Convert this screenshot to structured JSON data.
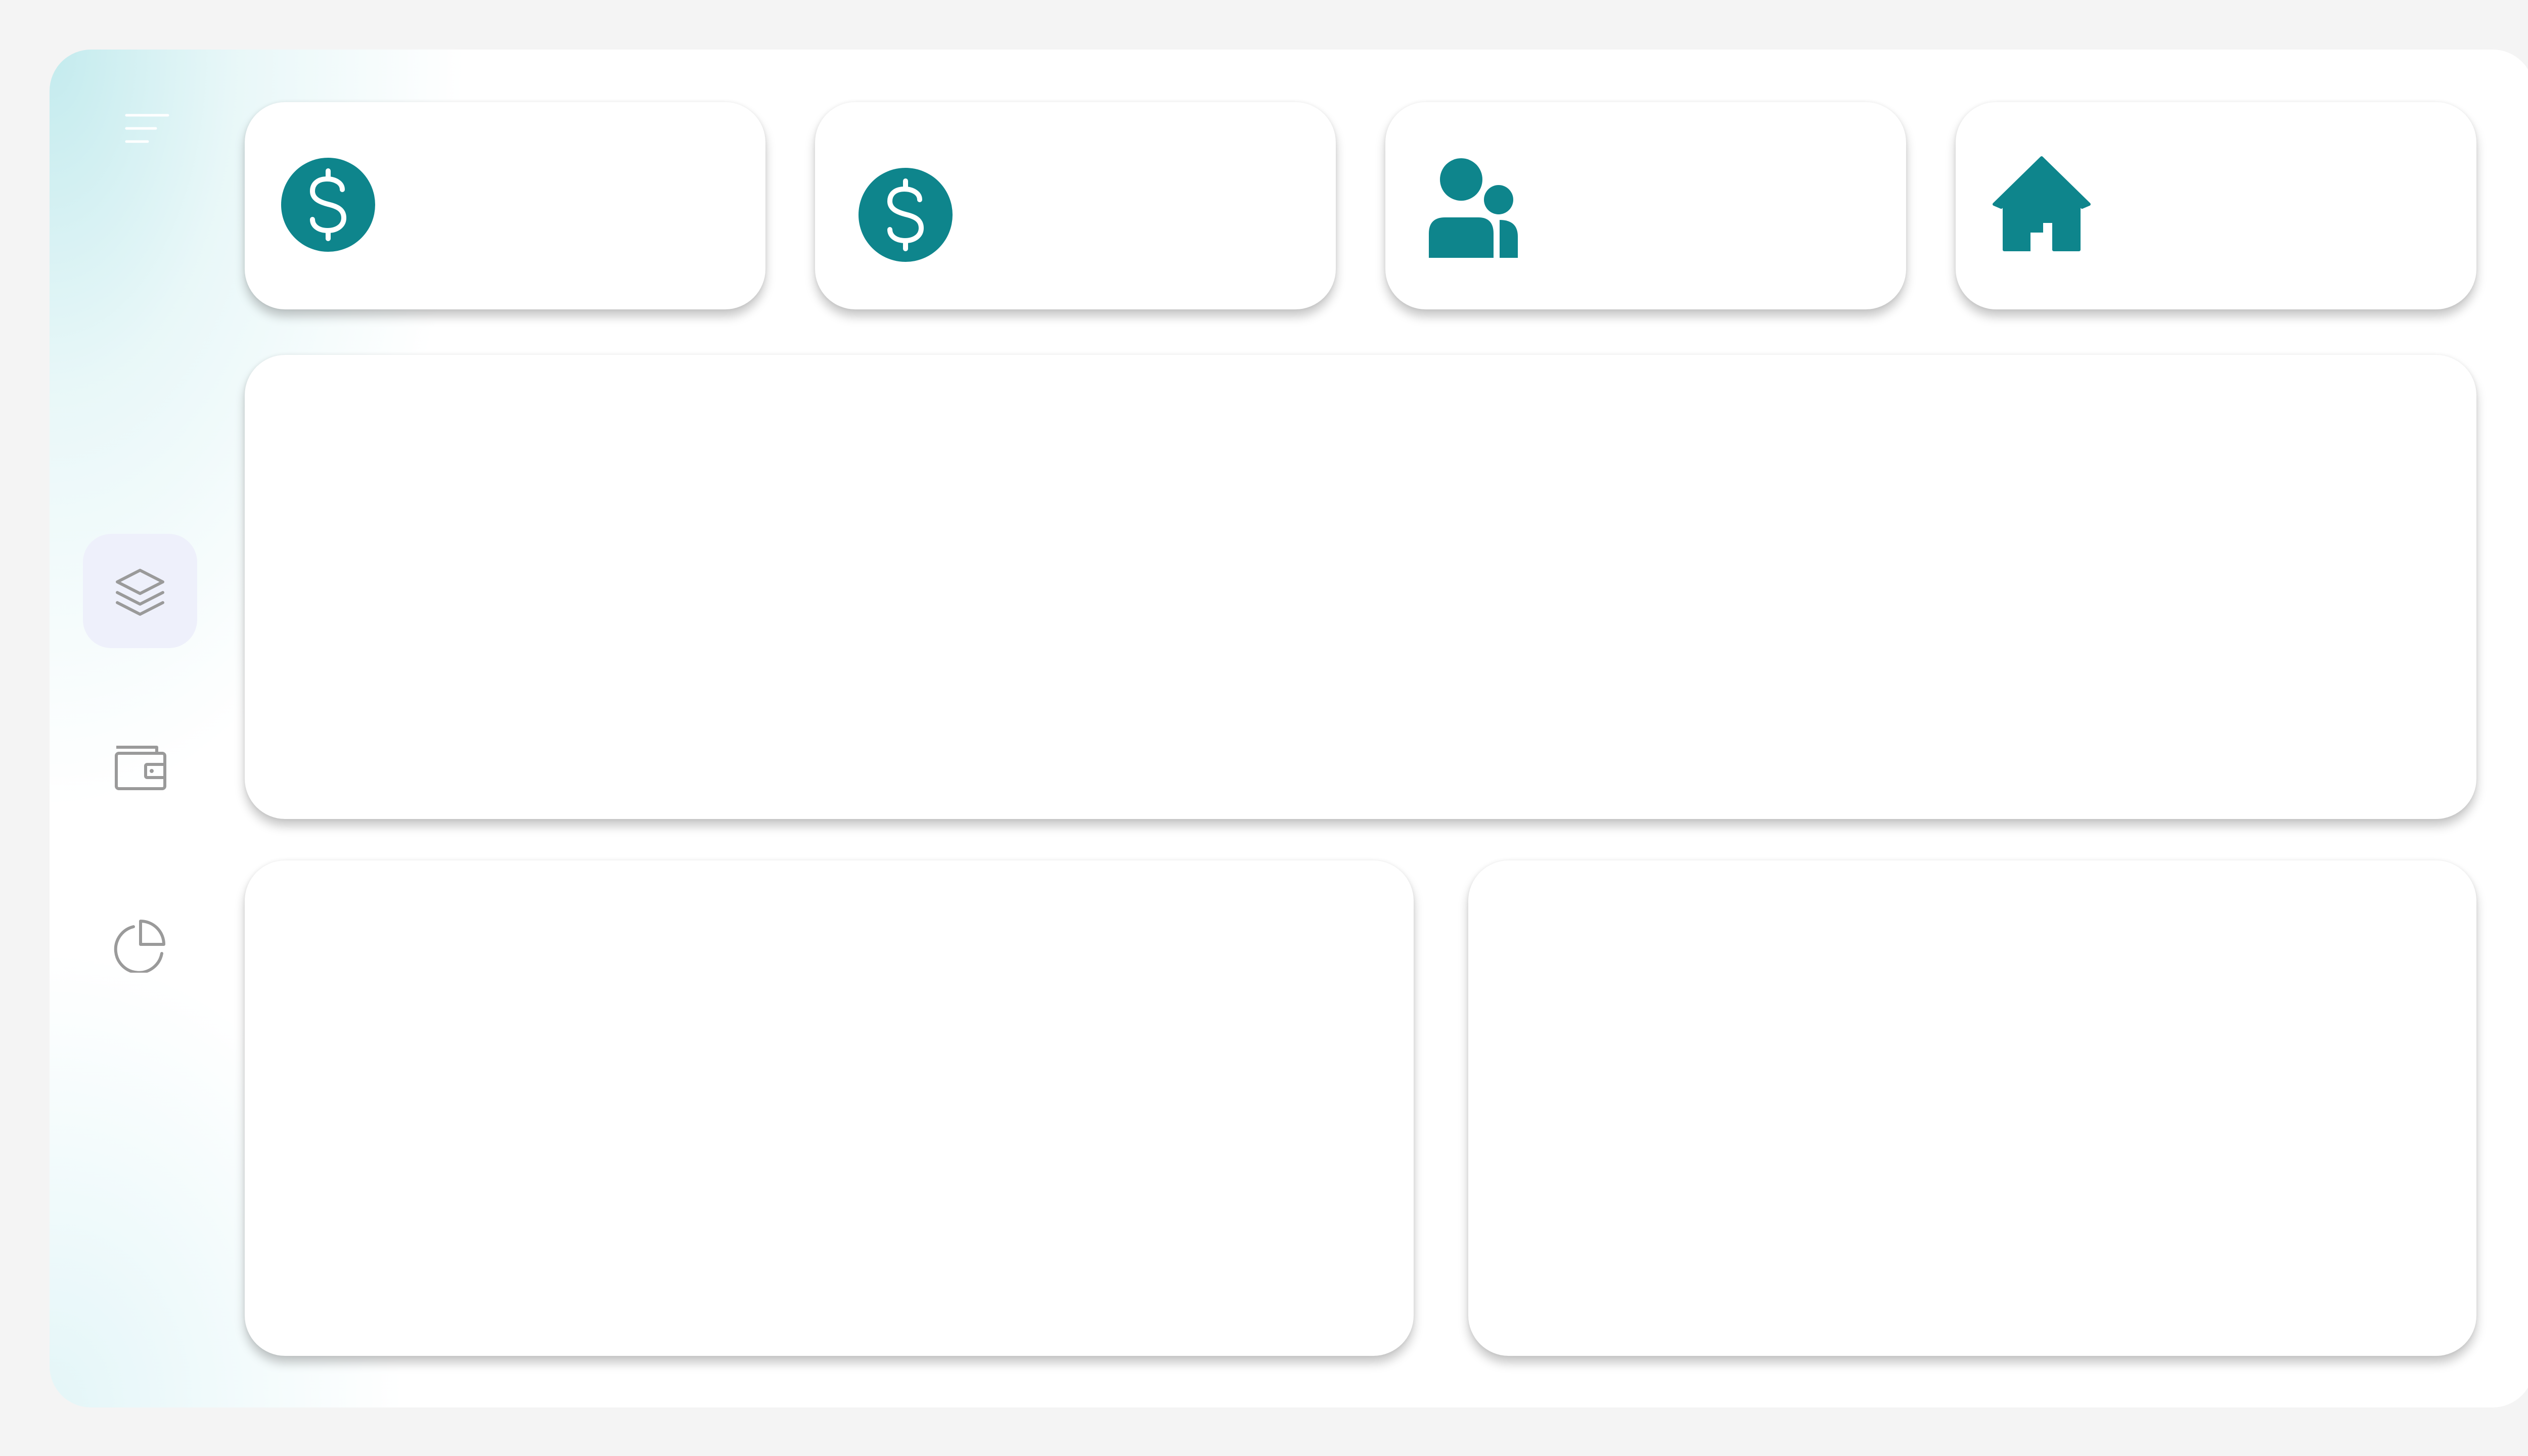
{
  "sidebar": {
    "menu_icon": "hamburger-menu-icon",
    "items": [
      {
        "id": "layers",
        "icon": "layers-icon",
        "active": true
      },
      {
        "id": "wallet",
        "icon": "wallet-icon",
        "active": false
      },
      {
        "id": "pie-chart",
        "icon": "pie-chart-icon",
        "active": false
      }
    ]
  },
  "stat_cards": [
    {
      "icon": "dollar-circle-icon"
    },
    {
      "icon": "dollar-circle-icon"
    },
    {
      "icon": "users-icon"
    },
    {
      "icon": "home-icon"
    }
  ],
  "colors": {
    "accent": "#0e858c",
    "nav_active_bg": "#eef0fb",
    "nav_icon": "#9a9a9a",
    "page_bg": "#f4f4f4",
    "card_bg": "#ffffff"
  }
}
